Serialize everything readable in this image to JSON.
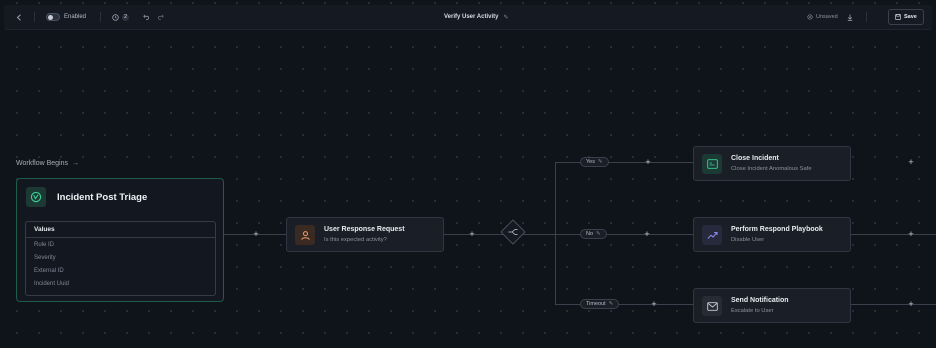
{
  "toolbar": {
    "status_label": "Enabled",
    "version_count": "2",
    "workflow_title": "Verify User Activity",
    "unsaved_label": "Unsaved",
    "save_label": "Save"
  },
  "canvas": {
    "begins_label": "Workflow Begins",
    "trigger": {
      "title": "Incident Post Triage",
      "values_header": "Values",
      "values": [
        "Rule ID",
        "Severity",
        "External ID",
        "Incident Uuid"
      ]
    },
    "user_response": {
      "title": "User Response Request",
      "subtitle": "Is this expected activity?"
    },
    "branches": {
      "yes": "Yes",
      "no": "No",
      "timeout": "Timeout"
    },
    "actions": [
      {
        "title": "Close Incident",
        "subtitle": "Close Incident Anomalous Safe"
      },
      {
        "title": "Perform Respond Playbook",
        "subtitle": "Disable User"
      },
      {
        "title": "Send Notification",
        "subtitle": "Escalate to User"
      }
    ]
  },
  "colors": {
    "background": "#0f131a",
    "trigger_border": "#1f5c4a",
    "accent_green": "#3bd29a",
    "accent_orange": "#f0a070",
    "accent_purple": "#8c8cf5"
  }
}
